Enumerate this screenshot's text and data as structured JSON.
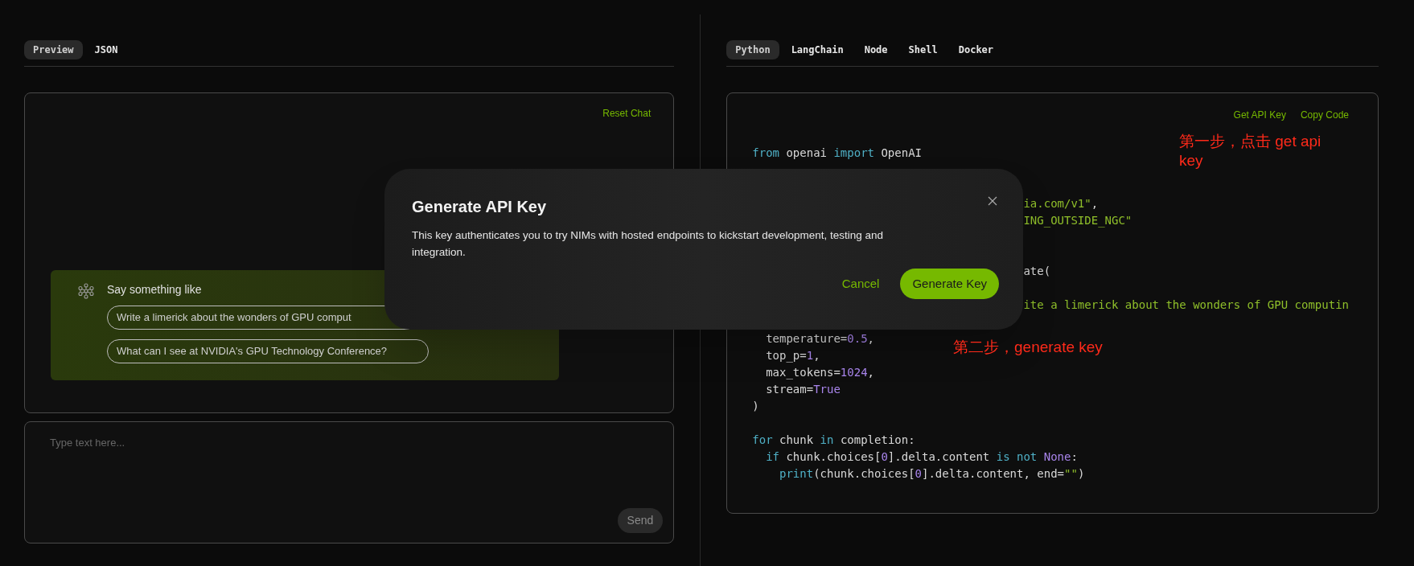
{
  "preview_panel": {
    "tabs": [
      {
        "label": "Preview",
        "selected": true
      },
      {
        "label": "JSON",
        "selected": false
      }
    ],
    "chat": {
      "reset_link": "Reset Chat",
      "suggestions": {
        "heading": "Say something like",
        "chips": [
          "Write a limerick about the wonders of GPU comput",
          "What can I see at NVIDIA's GPU Technology Conference?"
        ]
      }
    },
    "input": {
      "placeholder": "Type text here...",
      "send_button": "Send"
    }
  },
  "code_panel": {
    "tabs": [
      {
        "label": "Python",
        "selected": true
      },
      {
        "label": "LangChain",
        "selected": false
      },
      {
        "label": "Node",
        "selected": false
      },
      {
        "label": "Shell",
        "selected": false
      },
      {
        "label": "Docker",
        "selected": false
      }
    ],
    "actions": [
      "Get API Key",
      "Copy Code"
    ],
    "lines": [
      {
        "tokens": [
          {
            "text": "from",
            "kind": "keyword"
          },
          {
            "text": " openai ",
            "kind": "plain"
          },
          {
            "text": "import",
            "kind": "keyword"
          },
          {
            "text": " OpenAI",
            "kind": "plain"
          }
        ]
      },
      {
        "tokens": [
          {
            "text": "ia.com/v1\"",
            "kind": "string"
          },
          {
            "text": ",",
            "kind": "plain"
          }
        ]
      },
      {
        "tokens": [
          {
            "text": "ING_OUTSIDE_NGC\"",
            "kind": "string"
          }
        ]
      },
      {
        "tokens": [
          {
            "text": "ate(",
            "kind": "plain"
          }
        ]
      },
      {
        "tokens": [
          {
            "text": "ite a limerick about the wonders of GPU computin",
            "kind": "string"
          }
        ]
      },
      {
        "tokens": [
          {
            "text": "temperature=",
            "kind": "plain"
          },
          {
            "text": "0.5",
            "kind": "number"
          },
          {
            "text": ",",
            "kind": "plain"
          }
        ]
      },
      {
        "tokens": [
          {
            "text": "top_p=",
            "kind": "plain"
          },
          {
            "text": "1",
            "kind": "number"
          },
          {
            "text": ",",
            "kind": "plain"
          }
        ]
      },
      {
        "tokens": [
          {
            "text": "max_tokens=",
            "kind": "plain"
          },
          {
            "text": "1024",
            "kind": "number"
          },
          {
            "text": ",",
            "kind": "plain"
          }
        ]
      },
      {
        "tokens": [
          {
            "text": "stream=",
            "kind": "plain"
          },
          {
            "text": "True",
            "kind": "number"
          }
        ]
      },
      {
        "tokens": [
          {
            "text": ")",
            "kind": "plain"
          }
        ]
      },
      {
        "tokens": [
          {
            "text": "for",
            "kind": "keyword"
          },
          {
            "text": " chunk ",
            "kind": "plain"
          },
          {
            "text": "in",
            "kind": "keyword"
          },
          {
            "text": " completion:",
            "kind": "plain"
          }
        ]
      },
      {
        "tokens": [
          {
            "text": "if",
            "kind": "keyword"
          },
          {
            "text": " chunk.choices[",
            "kind": "plain"
          },
          {
            "text": "0",
            "kind": "number"
          },
          {
            "text": "].delta.content ",
            "kind": "plain"
          },
          {
            "text": "is not ",
            "kind": "keyword"
          },
          {
            "text": "None",
            "kind": "number"
          },
          {
            "text": ":",
            "kind": "plain"
          }
        ]
      },
      {
        "tokens": [
          {
            "text": "print",
            "kind": "keyword"
          },
          {
            "text": "(chunk.choices[",
            "kind": "plain"
          },
          {
            "text": "0",
            "kind": "number"
          },
          {
            "text": "].delta.content, end=",
            "kind": "plain"
          },
          {
            "text": "\"\"",
            "kind": "string"
          },
          {
            "text": ")",
            "kind": "plain"
          }
        ]
      }
    ]
  },
  "dialog": {
    "title": "Generate API Key",
    "message": "This key authenticates you to try NIMs with hosted endpoints to kickstart development, testing and integration.",
    "buttons": [
      {
        "label": "Cancel",
        "kind": "secondary"
      },
      {
        "label": "Generate Key",
        "kind": "primary"
      }
    ]
  },
  "annotations": [
    "第一步，点击 get api key",
    "第二步，generate key"
  ]
}
